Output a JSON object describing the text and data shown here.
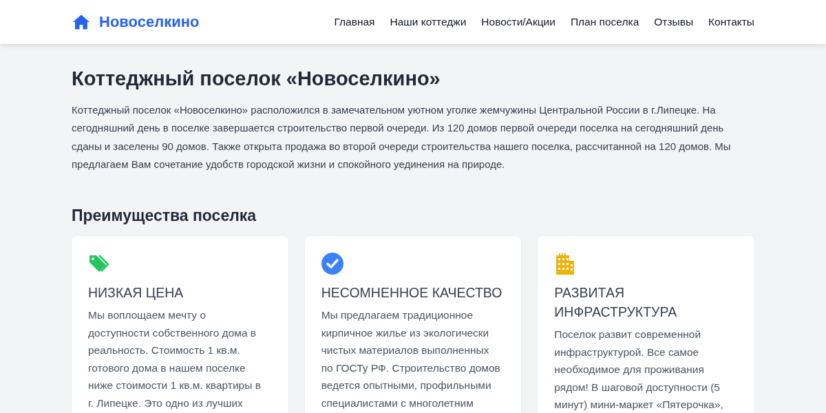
{
  "header": {
    "logo": "Новоселкино",
    "nav": [
      {
        "label": "Главная"
      },
      {
        "label": "Наши коттеджи"
      },
      {
        "label": "Новости/Акции"
      },
      {
        "label": "План поселка"
      },
      {
        "label": "Отзывы"
      },
      {
        "label": "Контакты"
      }
    ]
  },
  "intro": {
    "title": "Коттеджный поселок «Новоселкино»",
    "text": "Коттеджный поселок «Новоселкино» расположился в замечательном уютном уголке жемчужины Центральной России в г.Липецке. На сегодняшний день в поселке завершается строительство первой очереди. Из 120 домов первой очереди поселка на сегодняшний день сданы и заселены 90 домов. Также открыта продажа во второй очереди строительства нашего поселка, рассчитанной на 120 домов. Мы предлагаем Вам сочетание удобств городской жизни и спокойного уединения на природе."
  },
  "advantages": {
    "title": "Преимущества поселка",
    "cards": [
      {
        "kind": "tags",
        "color": "#22c55e",
        "title": "НИЗКАЯ ЦЕНА",
        "text_lines": [
          "Мы воплощаем мечту о",
          "доступности собственного дома в",
          "реальность. Стоимость 1 кв.м.",
          "готового дома в нашем поселке",
          "ниже стоимости 1 кв.м. квартиры в",
          "г. Липецке. Это одно из лучших"
        ]
      },
      {
        "kind": "check",
        "color": "#3b82f6",
        "title": "НЕСОМНЕННОЕ КАЧЕСТВО",
        "text_lines": [
          "Мы предлагаем традиционное",
          "кирпичное жилье из экологически",
          "чистых материалов выполненных",
          "по ГОСТу РФ. Строительство домов",
          "ведется опытными, профильными",
          "специалистами с многолетним"
        ]
      },
      {
        "kind": "city",
        "color": "#eab308",
        "title": "РАЗВИТАЯ ИНФРАСТРУКТУРА",
        "text_lines": [
          "Поселок развит современной",
          "инфраструктурой. Все самое",
          "необходимое для проживания",
          "рядом! В шаговой доступности (5",
          "минут) мини-маркет «Пятерочка»,"
        ]
      }
    ]
  }
}
